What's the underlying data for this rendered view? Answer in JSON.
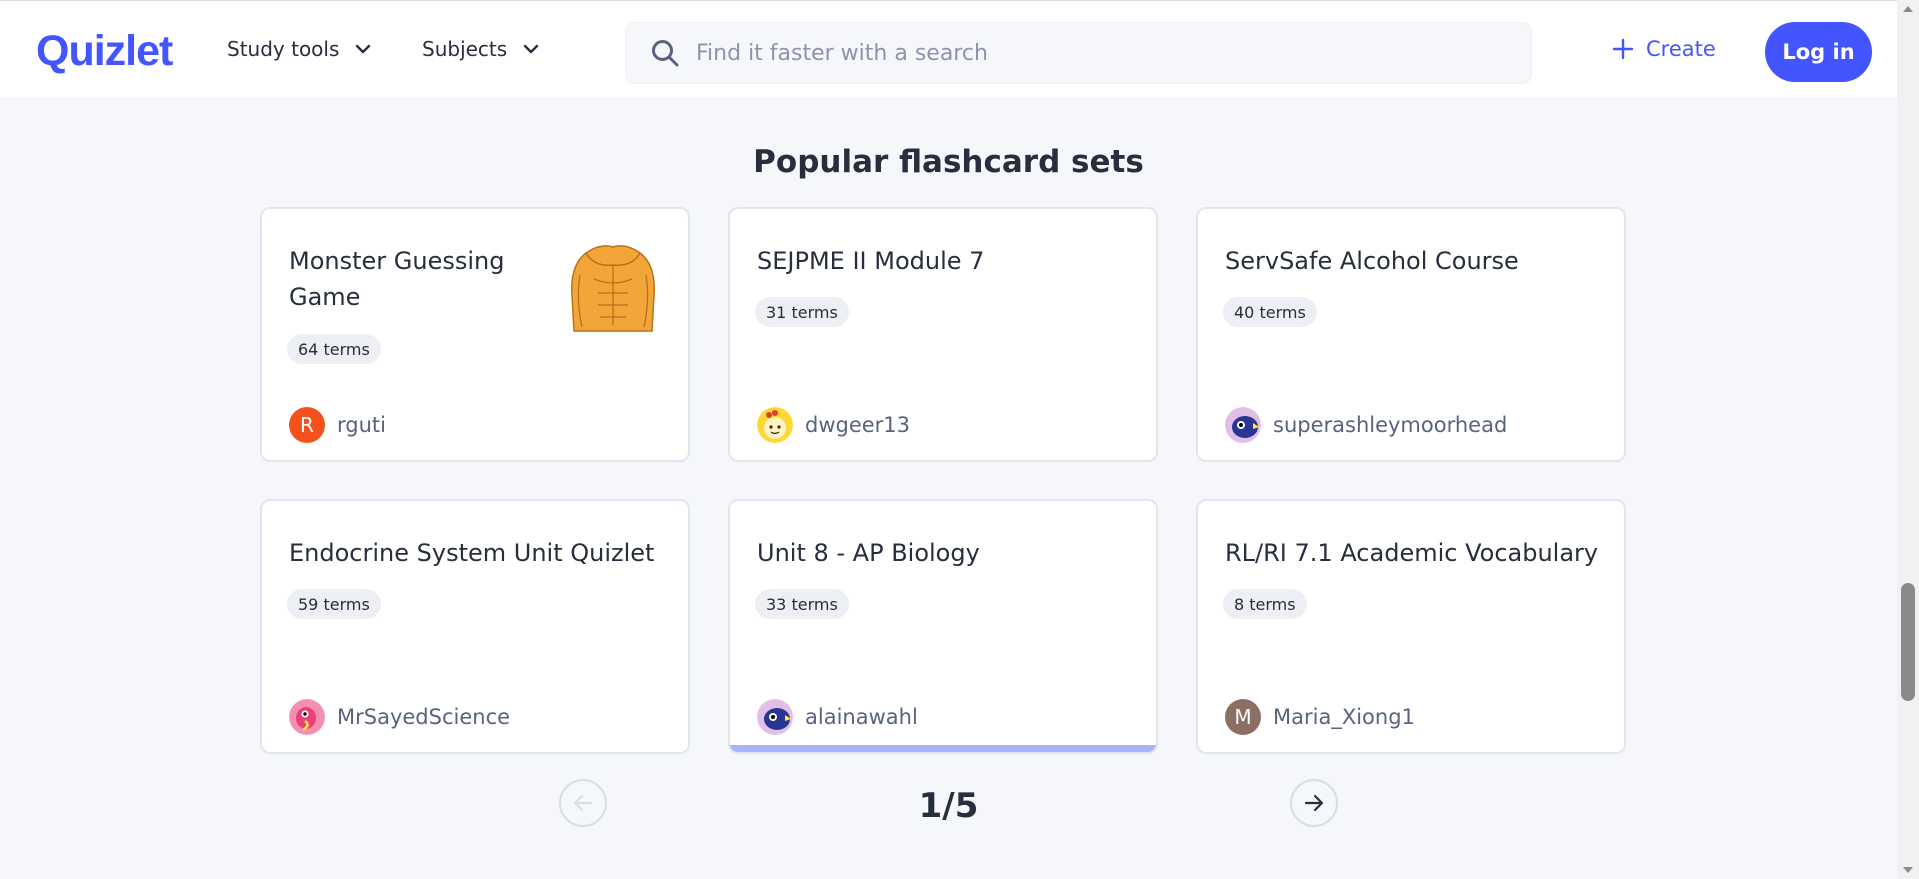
{
  "header": {
    "logo": "Quizlet",
    "study_tools": "Study tools",
    "subjects": "Subjects",
    "search_placeholder": "Find it faster with a search",
    "create": "Create",
    "login": "Log in"
  },
  "section": {
    "title": "Popular flashcard sets"
  },
  "cards": [
    {
      "title": "Monster Guessing Game",
      "terms": "64 terms",
      "user": "rguti",
      "avatar_letter": "R",
      "avatar_color": "#f4511e"
    },
    {
      "title": "SEJPME II Module 7",
      "terms": "31 terms",
      "user": "dwgeer13"
    },
    {
      "title": "ServSafe Alcohol Course",
      "terms": "40 terms",
      "user": "superashleymoorhead"
    },
    {
      "title": "Endocrine System Unit Quizlet",
      "terms": "59 terms",
      "user": "MrSayedScience"
    },
    {
      "title": "Unit 8 - AP Biology",
      "terms": "33 terms",
      "user": "alainawahl"
    },
    {
      "title": "RL/RI 7.1 Academic Vocabulary",
      "terms": "8 terms",
      "user": "Maria_Xiong1",
      "avatar_letter": "M",
      "avatar_color": "#8d6e63"
    }
  ],
  "pagination": {
    "label": "1/5"
  },
  "colors": {
    "brand": "#4255ff",
    "background": "#f6f7fb",
    "text": "#282e3e",
    "muted": "#586380"
  },
  "icons": [
    "chevron-down-icon",
    "search-icon",
    "plus-icon",
    "arrow-left-icon",
    "arrow-right-icon"
  ]
}
